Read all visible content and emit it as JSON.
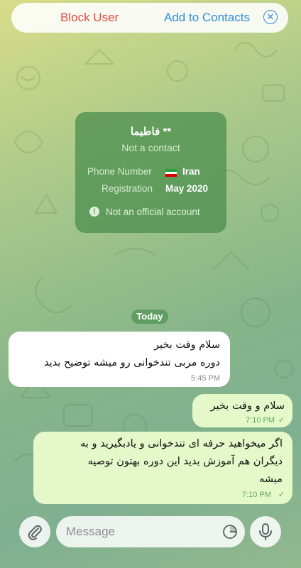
{
  "topbar": {
    "block_label": "Block User",
    "add_label": "Add to Contacts",
    "close_icon": "circle-x-icon"
  },
  "contact_card": {
    "name": "فاطیما **",
    "subtitle": "Not a contact",
    "phone_label": "Phone Number",
    "phone_country": "Iran",
    "registration_label": "Registration",
    "registration_value": "May 2020",
    "note": "Not an official account",
    "flag_colors": [
      "#239f40",
      "#ffffff",
      "#da0000"
    ]
  },
  "date_separator": "Today",
  "messages": [
    {
      "direction": "incoming",
      "lines": [
        "سلام وقت بخیر",
        "دوره مربی تندخوانی رو میشه توضیح بدید"
      ],
      "time": "5:45 PM"
    },
    {
      "direction": "outgoing",
      "lines": [
        "سلام و وقت بخیر"
      ],
      "time": "7:10 PM",
      "read": true
    },
    {
      "direction": "outgoing",
      "lines": [
        "اگر میخواهید حرفه ای تندخوانی و یادبگیرید و به",
        "دیگران هم آموزش بدید این دوره بهتون توصیه",
        "میشه"
      ],
      "time": "7:10 PM",
      "read": true
    }
  ],
  "input": {
    "placeholder": "Message",
    "value": "",
    "attach_icon": "paperclip-icon",
    "sticker_icon": "sticker-icon",
    "mic_icon": "microphone-icon"
  },
  "colors": {
    "block": "#e5473f",
    "accent": "#2f8be0",
    "outgoing_bubble": "#e5f8c9",
    "card_bg": "#468c4b"
  }
}
